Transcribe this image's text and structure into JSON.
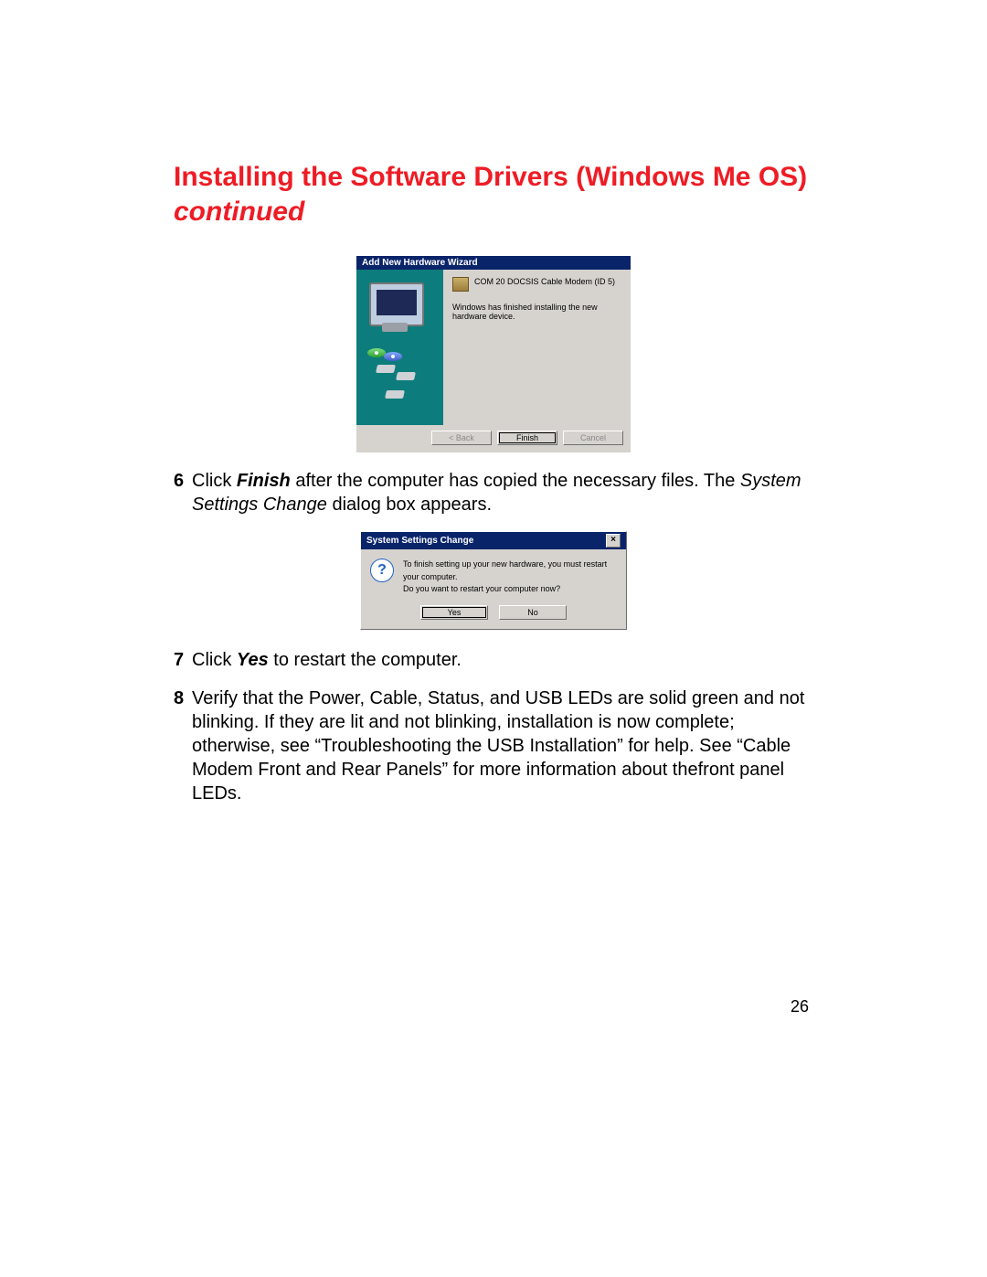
{
  "heading": {
    "title": "Installing the Software Drivers (Windows Me OS)",
    "continued": "continued"
  },
  "wizard": {
    "title": "Add New Hardware Wizard",
    "device": "COM 20 DOCSIS Cable Modem (ID 5)",
    "status": "Windows has finished installing the new hardware device.",
    "buttons": {
      "back": "< Back",
      "finish": "Finish",
      "cancel": "Cancel"
    }
  },
  "step6": {
    "num": "6",
    "pre": " Click ",
    "bold": "Finish",
    "mid": " after the computer has copied the necessary files. The ",
    "italic": "System Settings Change",
    "post": " dialog box appears."
  },
  "dialog": {
    "title": "System Settings Change",
    "line1": "To finish setting up your new hardware, you must restart your computer.",
    "line2": "Do you want to restart your computer now?",
    "yes": "Yes",
    "no": "No"
  },
  "step7": {
    "num": "7",
    "pre": " Click ",
    "bold": "Yes",
    "post": " to restart the computer."
  },
  "step8": {
    "num": "8",
    "text": " Verify that the Power, Cable, Status, and USB LEDs are solid green and not blinking. If they are lit and not blinking, installation is now complete; otherwise, see “Troubleshooting the USB Installation” for help. See “Cable Modem Front and Rear Panels” for more information about thefront panel LEDs."
  },
  "pageNumber": "26"
}
